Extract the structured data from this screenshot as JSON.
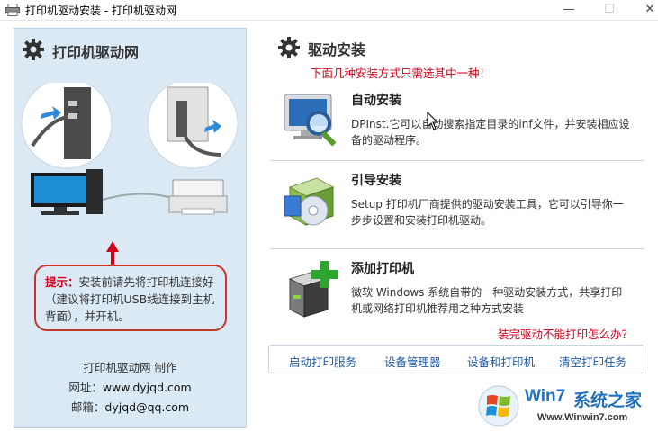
{
  "window": {
    "title": "打印机驱动安装 - 打印机驱动网",
    "controls": {
      "minimize": "—",
      "maximize": "☐",
      "close": "✕"
    }
  },
  "left": {
    "title": "打印机驱动网",
    "tip_label": "提示：",
    "tip_text": "安装前请先将打印机连接好（建议将打印机USB线连接到主机背面），并开机。",
    "credits": {
      "maker": "打印机驱动网  制作",
      "site_label": "网址：",
      "site_value": "www.dyjqd.com",
      "email_label": "邮箱：",
      "email_value": "dyjqd@qq.com"
    }
  },
  "right": {
    "title": "驱动安装",
    "subtitle": "下面几种安装方式只需选其中一种！",
    "options": [
      {
        "title": "自动安装",
        "desc": "DPInst.它可以自动搜索指定目录的inf文件，并安装相应设备的驱动程序。",
        "icon": "magnifier-monitor-icon"
      },
      {
        "title": "引导安装",
        "desc": "Setup 打印机厂商提供的驱动安装工具，它可以引导你一步步设置和安装打印机驱动。",
        "icon": "setup-box-icon"
      },
      {
        "title": "添加打印机",
        "desc": "微软 Windows 系统自带的一种驱动安装方式，共享打印机或网络打印机推荐用之种方式安装",
        "icon": "add-printer-icon"
      }
    ],
    "help_link": "装完驱动不能打印怎么办？",
    "buttons": [
      "启动打印服务",
      "设备管理器",
      "设备和打印机",
      "清空打印任务"
    ]
  },
  "watermark": {
    "brand_a": "Win7",
    "brand_b": "系统之家",
    "url": "Www.Winwin7.com"
  },
  "colors": {
    "accent_red": "#d0021b",
    "link_blue": "#1a56a8",
    "panel_bg": "#dbe9f4"
  }
}
